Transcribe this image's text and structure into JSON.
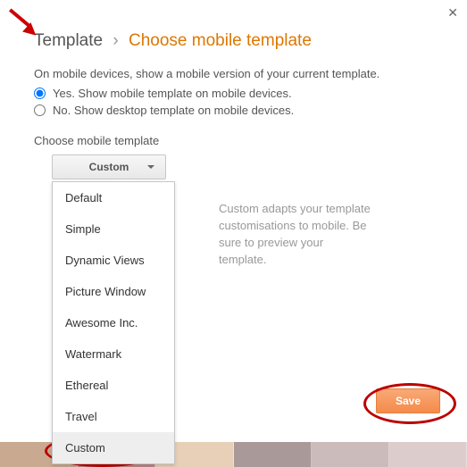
{
  "breadcrumb": {
    "root": "Template",
    "current": "Choose mobile template"
  },
  "description": "On mobile devices, show a mobile version of your current template.",
  "radios": {
    "yes": "Yes. Show mobile template on mobile devices.",
    "no": "No. Show desktop template on mobile devices."
  },
  "section_label": "Choose mobile template",
  "dropdown": {
    "selected": "Custom",
    "items": [
      "Default",
      "Simple",
      "Dynamic Views",
      "Picture Window",
      "Awesome Inc.",
      "Watermark",
      "Ethereal",
      "Travel",
      "Custom"
    ]
  },
  "helper": "Custom adapts your template customisations to mobile. Be sure to preview your template.",
  "save_label": "Save",
  "close_glyph": "✕"
}
